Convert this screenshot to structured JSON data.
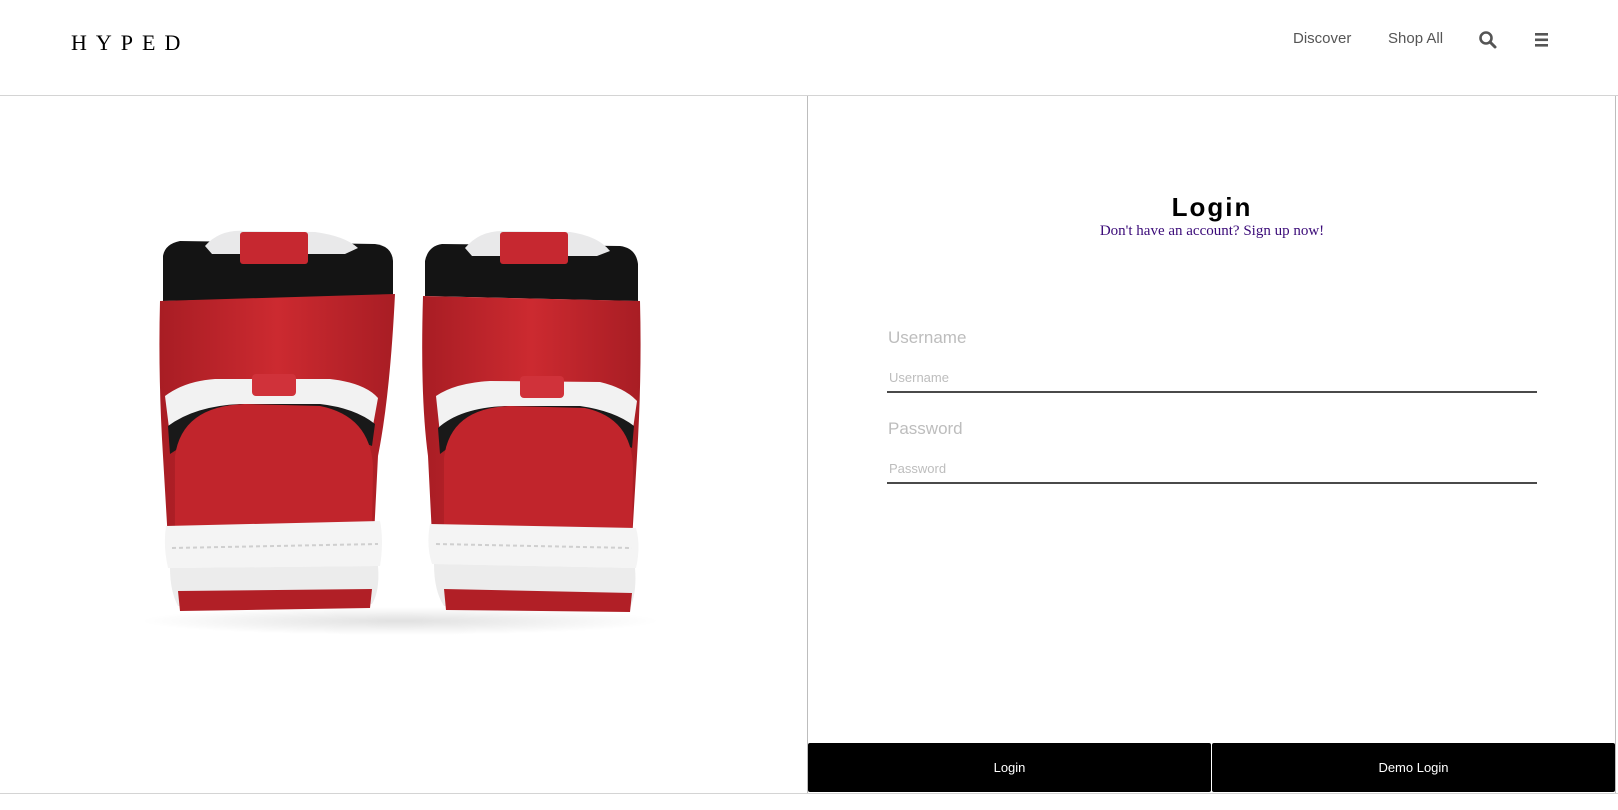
{
  "header": {
    "logo": "HYPED",
    "nav_links": [
      "Discover",
      "Shop All"
    ],
    "icons": [
      "search-icon",
      "hamburger-menu-icon"
    ]
  },
  "hero": {
    "image": "red-white-black-high-top-sneakers-rear-view"
  },
  "login": {
    "title": "Login",
    "signup_prompt": "Don't have an account? Sign up now!",
    "username": {
      "label": "Username",
      "placeholder": "Username",
      "value": ""
    },
    "password": {
      "label": "Password",
      "placeholder": "Password",
      "value": ""
    },
    "buttons": {
      "login": "Login",
      "demo": "Demo Login"
    }
  },
  "colors": {
    "accent_link": "#3a0a78",
    "button_bg": "#000000",
    "button_text": "#ffffff",
    "placeholder": "#bdbdbd",
    "sneaker_red": "#c0262c"
  }
}
